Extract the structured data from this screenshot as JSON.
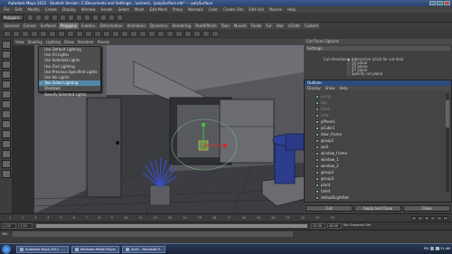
{
  "window": {
    "title": "Autodesk Maya 2012 - Student Version: C:\\Documents and Settings\\...\\scenes\\...\\polySurface.mb*  ---  polySurface"
  },
  "menubar": [
    "File",
    "Edit",
    "Modify",
    "Create",
    "Display",
    "Window",
    "Assets",
    "Select",
    "Mesh",
    "Edit Mesh",
    "Proxy",
    "Normals",
    "Color",
    "Create UVs",
    "Edit UVs",
    "Muscle",
    "Help"
  ],
  "statusline": {
    "mode": "Polygons"
  },
  "shelftabs": [
    "General",
    "Curves",
    "Surfaces",
    "Polygons",
    "Subdivs",
    "Deformation",
    "Animation",
    "Dynamics",
    "Rendering",
    "PaintEffects",
    "Toon",
    "Muscle",
    "Fluids",
    "Fur",
    "Hair",
    "nCloth",
    "Custom"
  ],
  "shelftab_active": "Polygons",
  "panelmenu": [
    "View",
    "Shading",
    "Lighting",
    "Show",
    "Renderer",
    "Panels"
  ],
  "lighting_menu": [
    {
      "label": "Use Default Lighting",
      "checked": false,
      "highlighted": false
    },
    {
      "label": "Use All Lights",
      "checked": false,
      "highlighted": false
    },
    {
      "label": "Use Selected Lights",
      "checked": false,
      "highlighted": false
    },
    {
      "label": "Use Flat Lighting",
      "checked": false,
      "highlighted": false
    },
    {
      "label": "Use Previous Specified Lights",
      "checked": false,
      "highlighted": false
    },
    {
      "label": "Use No Lights",
      "checked": false,
      "highlighted": false
    },
    {
      "label": "Two Sided Lighting",
      "checked": true,
      "highlighted": true
    },
    {
      "label": "Shadows",
      "checked": false,
      "highlighted": false
    },
    {
      "label": "Specify Selected Lights",
      "checked": false,
      "highlighted": false
    }
  ],
  "right_panel": {
    "header": "Cut Faces Options",
    "settings_label": "Settings",
    "cut_direction_label": "Cut direction:",
    "options": [
      "Interactive (click for cut line)",
      "YZ plane",
      "ZX plane",
      "XY plane",
      "Specify cut plane"
    ]
  },
  "outliner": {
    "title": "Outliner",
    "menu": [
      "Display",
      "Show",
      "Help"
    ],
    "items": [
      {
        "label": "persp",
        "dim": true
      },
      {
        "label": "top",
        "dim": true
      },
      {
        "label": "front",
        "dim": true
      },
      {
        "label": "side",
        "dim": true
      },
      {
        "label": "pPlane1",
        "dim": false
      },
      {
        "label": "pCube1",
        "dim": false
      },
      {
        "label": "door_frame",
        "dim": false
      },
      {
        "label": "group1",
        "dim": false
      },
      {
        "label": "wall",
        "dim": false
      },
      {
        "label": "window_frame",
        "dim": false
      },
      {
        "label": "window_1",
        "dim": false
      },
      {
        "label": "window_2",
        "dim": false
      },
      {
        "label": "group2",
        "dim": false
      },
      {
        "label": "group3",
        "dim": false
      },
      {
        "label": "plant",
        "dim": false
      },
      {
        "label": "toilet",
        "dim": false
      },
      {
        "label": "defaultLightSet",
        "dim": false
      }
    ]
  },
  "buttons": [
    "Cut",
    "Apply and Close",
    "Close"
  ],
  "timeline": {
    "ticks": [
      "1",
      "2",
      "3",
      "4",
      "5",
      "6",
      "7",
      "8",
      "9",
      "10",
      "11",
      "12",
      "13",
      "14",
      "15",
      "16",
      "17",
      "18",
      "19",
      "20",
      "21",
      "22",
      "23",
      "24"
    ]
  },
  "range": {
    "start": "1.00",
    "start2": "1.00",
    "end": "24.00",
    "end2": "48.00",
    "char_set": "No Character Set"
  },
  "cmdline": {
    "mel": "MEL"
  },
  "taskbar": {
    "tasks": [
      "Autodesk Maya 2012 - ...",
      "Windows Media Player",
      "Anim - Microsoft P..."
    ],
    "tray_lang": "EN",
    "clock": "11:11 AM"
  }
}
